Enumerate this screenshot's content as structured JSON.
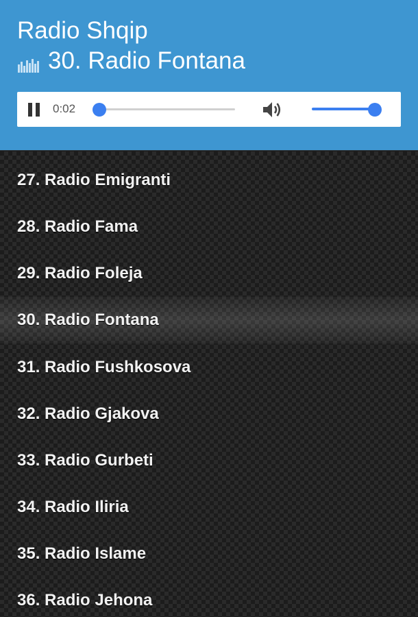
{
  "header": {
    "app_title": "Radio Shqip",
    "now_playing": "30. Radio Fontana",
    "now_playing_icon": "equalizer-icon"
  },
  "player": {
    "state": "playing",
    "elapsed": "0:02",
    "seek_position": 0.0,
    "volume_level": 1.0,
    "accent_color": "#3b7ff0"
  },
  "colors": {
    "header_bg": "#3e96d1",
    "list_text": "#f2f2f2"
  },
  "stations": [
    {
      "label": "27. Radio Emigranti",
      "active": false
    },
    {
      "label": "28. Radio Fama",
      "active": false
    },
    {
      "label": "29. Radio Foleja",
      "active": false
    },
    {
      "label": "30. Radio Fontana",
      "active": true
    },
    {
      "label": "31. Radio Fushkosova",
      "active": false
    },
    {
      "label": "32. Radio Gjakova",
      "active": false
    },
    {
      "label": "33. Radio Gurbeti",
      "active": false
    },
    {
      "label": "34. Radio Iliria",
      "active": false
    },
    {
      "label": "35. Radio Islame",
      "active": false
    },
    {
      "label": "36. Radio Jehona",
      "active": false
    }
  ]
}
